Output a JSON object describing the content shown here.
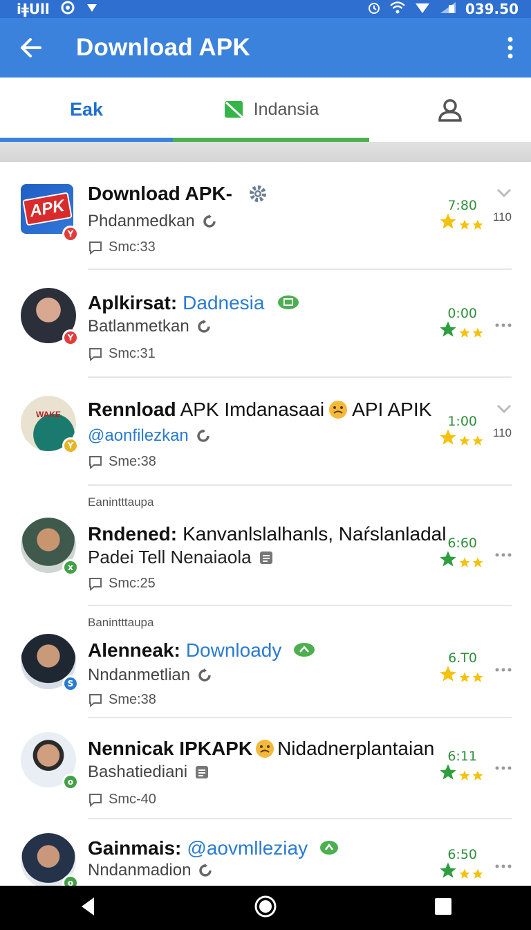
{
  "status_bar": {
    "signal_text": "iǂUll",
    "time": "039.50"
  },
  "app_bar": {
    "title": "Download APK"
  },
  "tabs": [
    {
      "label": "Eak",
      "underline_color": "#3b82dc"
    },
    {
      "label": "Indansia",
      "underline_color": "#4caf50"
    },
    {
      "label": "",
      "underline_color": ""
    }
  ],
  "items": [
    {
      "title": "Download APK-",
      "title_accent": "",
      "sub": "Phdanmedkan",
      "meta": "Smc:33",
      "rating": "7:80",
      "count": "110",
      "avatar_text": "APK",
      "section": ""
    },
    {
      "title": "Aplkirsat:",
      "title_accent": "Dadnesia",
      "sub": "Batlanmetkan",
      "meta": "Smc:31",
      "rating": "0:00",
      "count": "",
      "section": ""
    },
    {
      "title": "Rennload",
      "title_rest": "APK Imdanasaai",
      "title_tail": "API APIK",
      "sub": "@aonfilezkan",
      "meta": "Sme:38",
      "rating": "1:00",
      "count": "110",
      "avatar_text": "WAKE",
      "section": ""
    },
    {
      "title": "Rndened:",
      "title_rest": "Kanvanlslalhanls, Naŕslanladal",
      "sub": "Padei Tell Nenaiaola",
      "meta": "Smc:25",
      "rating": "6:60",
      "count": "",
      "section": "Eanintttaupa"
    },
    {
      "title": "Alenneak:",
      "title_accent": "Downloady",
      "sub": "Nndanmetlian",
      "meta": "Sme:38",
      "rating": "6.T0",
      "count": "",
      "section": "Banintttaupa"
    },
    {
      "title": "Nennicak IPKAPK",
      "title_rest": "Nidadnerplantaian",
      "sub": "Bashatiediani",
      "meta": "Smc-40",
      "rating": "6:11",
      "count": "",
      "section": ""
    },
    {
      "title": "Gainmais:",
      "title_accent": "@aovmlleziay",
      "sub": "Nndanmadion",
      "meta": "",
      "rating": "6:50",
      "count": "",
      "section": ""
    }
  ]
}
